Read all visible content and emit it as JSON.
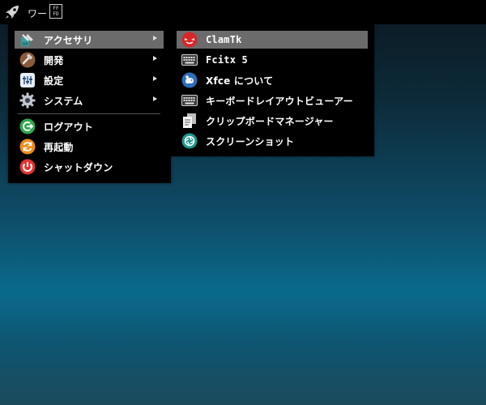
{
  "panel": {
    "launcher_icon": "rocket-icon",
    "window_label": "ワー",
    "input_indicator": {
      "line1": "FF",
      "line2": "FD"
    }
  },
  "main_menu": {
    "items": [
      {
        "label": "アクセサリ",
        "icon": "accessories-icon",
        "has_submenu": true,
        "active": true
      },
      {
        "label": "開発",
        "icon": "development-icon",
        "has_submenu": true
      },
      {
        "label": "設定",
        "icon": "settings-icon",
        "has_submenu": true
      },
      {
        "label": "システム",
        "icon": "system-gear-icon",
        "has_submenu": true
      }
    ],
    "actions": [
      {
        "label": "ログアウト",
        "icon": "logout-icon"
      },
      {
        "label": "再起動",
        "icon": "restart-icon"
      },
      {
        "label": "シャットダウン",
        "icon": "shutdown-icon"
      }
    ]
  },
  "submenu": {
    "items": [
      {
        "label": "ClamTk",
        "icon": "clamtk-icon",
        "active": true
      },
      {
        "label": "Fcitx 5",
        "icon": "keyboard-icon"
      },
      {
        "label": "Xfce について",
        "icon": "xfce-mouse-icon"
      },
      {
        "label": "キーボードレイアウトビューアー",
        "icon": "keyboard-layout-icon"
      },
      {
        "label": "クリップボードマネージャー",
        "icon": "clipboard-icon"
      },
      {
        "label": "スクリーンショット",
        "icon": "screenshot-icon"
      }
    ]
  },
  "colors": {
    "menu_bg": "#000000",
    "highlight": "#6b6b6b",
    "text": "#ffffff"
  }
}
